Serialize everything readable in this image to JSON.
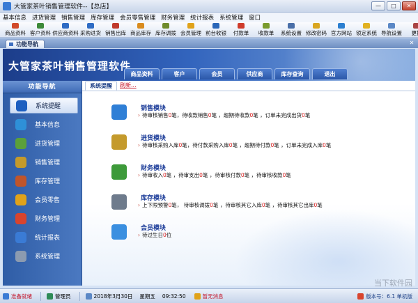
{
  "window": {
    "title": "大管家茶叶销售管理软件--【总店】",
    "controls": [
      "—",
      "□",
      "✕"
    ]
  },
  "menu": [
    "基本信息",
    "进货管理",
    "销售管理",
    "库存管理",
    "会员零售管理",
    "财务管理",
    "统计报表",
    "系统管理",
    "窗口"
  ],
  "toolbar": [
    {
      "label": "商品资料",
      "color": "#d14a2a"
    },
    {
      "label": "客户资料",
      "color": "#3d8a3a"
    },
    {
      "label": "供应商资料",
      "color": "#2f6cc4"
    },
    {
      "label": "采购进货",
      "color": "#2f6cc4"
    },
    {
      "label": "销售出库",
      "color": "#c0392b"
    },
    {
      "label": "商品库存",
      "color": "#d98b1e"
    },
    {
      "label": "库存调拨",
      "color": "#6f8b2b"
    },
    {
      "label": "会员管理",
      "color": "#e0a21a"
    },
    {
      "label": "前台收银",
      "color": "#2a66b8"
    },
    {
      "label": "付款单",
      "color": "#cf3b2b"
    },
    {
      "label": "收款单",
      "color": "#7a9b2d"
    },
    {
      "label": "系统设置",
      "color": "#4a6fa8"
    },
    {
      "label": "修改密码",
      "color": "#d9a621"
    },
    {
      "label": "官方网站",
      "color": "#2c7fd0"
    },
    {
      "label": "锁定系统",
      "color": "#e1b122"
    },
    {
      "label": "导航设置",
      "color": "#5b88c6"
    },
    {
      "label": "更换",
      "color": "#a44"
    }
  ],
  "doc_tab": {
    "label": "功能导航"
  },
  "header": {
    "app_name": "大管家茶叶销售管理软件",
    "nav_tabs": [
      "商品资料",
      "客户",
      "会员",
      "供应商",
      "库存查询",
      "退出"
    ]
  },
  "sidebar": {
    "title": "功能导航",
    "items": [
      {
        "label": "系统提醒",
        "icon": "info-icon",
        "color": "#1d5fc0"
      },
      {
        "label": "基本信息",
        "icon": "cubes-icon",
        "color": "#2e90d8"
      },
      {
        "label": "进货管理",
        "icon": "box-in-icon",
        "color": "#5ba03a"
      },
      {
        "label": "销售管理",
        "icon": "box-out-icon",
        "color": "#c49a2c"
      },
      {
        "label": "库存管理",
        "icon": "warehouse-icon",
        "color": "#c0552a"
      },
      {
        "label": "会员零售",
        "icon": "members-icon",
        "color": "#e0a21a"
      },
      {
        "label": "财务管理",
        "icon": "finance-icon",
        "color": "#d8442e"
      },
      {
        "label": "统计报表",
        "icon": "chart-icon",
        "color": "#3a7bd5"
      },
      {
        "label": "系统管理",
        "icon": "gears-icon",
        "color": "#8c9bb0"
      }
    ]
  },
  "content": {
    "tab_label": "系统提醒",
    "refresh_label": "刷新...",
    "modules": [
      {
        "title": "销售模块",
        "icon": "book-icon",
        "color": "#2f7fd6",
        "parts": [
          [
            "待审核销售",
            "0",
            "笔，待收款销售",
            "0",
            "笔 ，超期待收款",
            "0",
            "笔 ，订单未完成出货",
            "0",
            "笔"
          ]
        ]
      },
      {
        "title": "进货模块",
        "icon": "cart-box-icon",
        "color": "#c49a2c",
        "parts": [
          [
            "待审核采购入库",
            "0",
            "笔，待付款采购入库",
            "0",
            "笔 ，超期待付款",
            "0",
            "笔 ，订单未完成入库",
            "0",
            "笔"
          ]
        ]
      },
      {
        "title": "财务模块",
        "icon": "dollar-icon",
        "color": "#3d9a3a",
        "parts": [
          [
            "待审收入",
            "0",
            "笔 ，待审支出",
            "0",
            "笔 ，待审核付款",
            "0",
            "笔 ，待审核收款",
            "0",
            "笔"
          ]
        ]
      },
      {
        "title": "库存模块",
        "icon": "database-icon",
        "color": "#6e7b8c",
        "parts": [
          [
            "上下限预警",
            "0",
            "笔，  待审核调拨",
            "0",
            "笔 ，待审核其它入库",
            "0",
            "笔 ，待审核其它出库",
            "0",
            "笔"
          ]
        ]
      },
      {
        "title": "会员模块",
        "icon": "chat-icon",
        "color": "#3a8fe0",
        "parts": [
          [
            "待过生日",
            "0",
            "位"
          ]
        ]
      }
    ]
  },
  "statusbar": {
    "ready": "准备就绪",
    "user": "管理员",
    "date": "2018年3月30日",
    "weekday": "星期五",
    "time": "09:32:50",
    "message": "暂无消息",
    "version": "版本号：6.1 单机版"
  },
  "watermark": "当下软件园"
}
